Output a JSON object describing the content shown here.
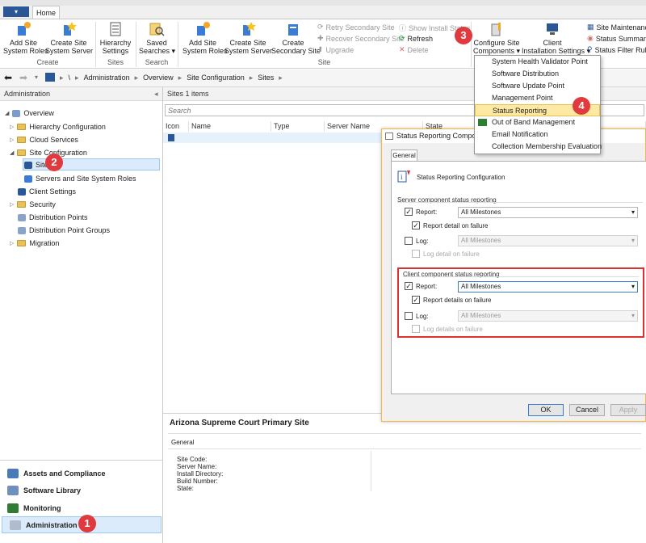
{
  "ribbon": {
    "home_tab": "Home",
    "groups": [
      "Create",
      "Sites",
      "Search",
      "Site"
    ],
    "buttons": {
      "add_site_roles": "Add Site\nSystem Roles",
      "create_site_server": "Create Site\nSystem Server",
      "hierarchy_settings": "Hierarchy\nSettings",
      "saved_searches": "Saved\nSearches ▾",
      "add_site_roles2": "Add Site\nSystem Roles",
      "create_site_server2": "Create Site\nSystem Server",
      "create_secondary": "Create\nSecondary Site",
      "retry_secondary": "Retry Secondary Site",
      "recover_secondary": "Recover Secondary Site",
      "upgrade": "Upgrade",
      "show_install_status": "Show Install Status",
      "refresh": "Refresh",
      "delete": "Delete",
      "configure_components": "Configure Site\nComponents ▾",
      "client_install": "Client\nInstallation Settings ▾",
      "site_maintenance": "Site Maintenance",
      "status_summarize": "Status Summarize",
      "status_filter": "Status Filter Rules"
    }
  },
  "address": {
    "path": [
      "\\",
      "Administration",
      "Overview",
      "Site Configuration",
      "Sites"
    ]
  },
  "left_pane": {
    "header": "Administration",
    "tree": {
      "overview": "Overview",
      "hierarchy_config": "Hierarchy Configuration",
      "cloud_services": "Cloud Services",
      "site_config": "Site Configuration",
      "sites": "Sites",
      "servers_roles": "Servers and Site System Roles",
      "client_settings": "Client Settings",
      "security": "Security",
      "distribution_points": "Distribution Points",
      "dp_groups": "Distribution Point Groups",
      "migration": "Migration"
    },
    "workspaces": [
      "Assets and Compliance",
      "Software Library",
      "Monitoring",
      "Administration"
    ]
  },
  "list_pane": {
    "header": "Sites 1 items",
    "search_placeholder": "Search",
    "columns": [
      "Icon",
      "Name",
      "Type",
      "Server Name",
      "State"
    ]
  },
  "details": {
    "title": "Arizona Supreme Court Primary Site",
    "tab": "General",
    "fields": [
      "Site Code:",
      "Server Name:",
      "Install Directory:",
      "Build Number:",
      "State:"
    ]
  },
  "menu": {
    "items": [
      "System Health Validator Point",
      "Software Distribution",
      "Software Update Point",
      "Management Point",
      "Status Reporting",
      "Out of Band Management",
      "Email Notification",
      "Collection Membership Evaluation"
    ],
    "highlighted_index": 4
  },
  "dialog": {
    "title": "Status Reporting Compone",
    "tab": "General",
    "heading": "Status Reporting Configuration",
    "server_group": "Server component status reporting",
    "client_group": "Client component status reporting",
    "report_label": "Report:",
    "log_label": "Log:",
    "report_value": "All Milestones",
    "log_value": "All Milestones",
    "server_detail": "Report detail on failure",
    "server_log_detail": "Log detail on failure",
    "client_detail": "Report details on failure",
    "client_log_detail": "Log details on failure",
    "ok": "OK",
    "cancel": "Cancel",
    "apply": "Apply"
  },
  "badges": [
    "1",
    "2",
    "3",
    "4"
  ],
  "colors": {
    "accent": "#2b5797",
    "badge": "#e03a3e",
    "highlight": "#fde9a4",
    "callout_border": "#d9322f"
  }
}
